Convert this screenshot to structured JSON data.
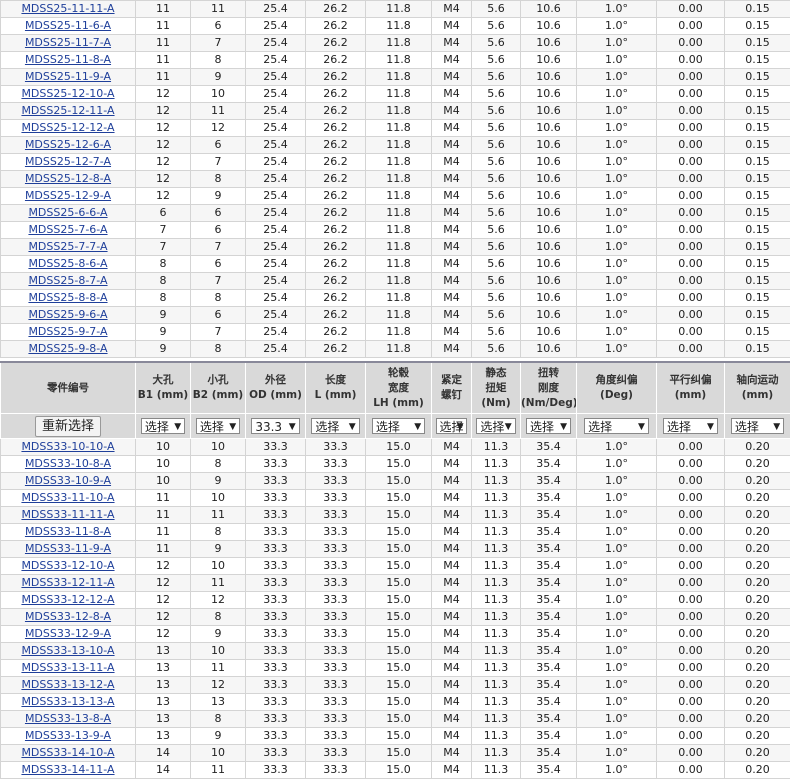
{
  "top_rows": [
    [
      "MDSS25-11-11-A",
      "11",
      "11",
      "25.4",
      "26.2",
      "11.8",
      "M4",
      "5.6",
      "10.6",
      "1.0°",
      "0.00",
      "0.15"
    ],
    [
      "MDSS25-11-6-A",
      "11",
      "6",
      "25.4",
      "26.2",
      "11.8",
      "M4",
      "5.6",
      "10.6",
      "1.0°",
      "0.00",
      "0.15"
    ],
    [
      "MDSS25-11-7-A",
      "11",
      "7",
      "25.4",
      "26.2",
      "11.8",
      "M4",
      "5.6",
      "10.6",
      "1.0°",
      "0.00",
      "0.15"
    ],
    [
      "MDSS25-11-8-A",
      "11",
      "8",
      "25.4",
      "26.2",
      "11.8",
      "M4",
      "5.6",
      "10.6",
      "1.0°",
      "0.00",
      "0.15"
    ],
    [
      "MDSS25-11-9-A",
      "11",
      "9",
      "25.4",
      "26.2",
      "11.8",
      "M4",
      "5.6",
      "10.6",
      "1.0°",
      "0.00",
      "0.15"
    ],
    [
      "MDSS25-12-10-A",
      "12",
      "10",
      "25.4",
      "26.2",
      "11.8",
      "M4",
      "5.6",
      "10.6",
      "1.0°",
      "0.00",
      "0.15"
    ],
    [
      "MDSS25-12-11-A",
      "12",
      "11",
      "25.4",
      "26.2",
      "11.8",
      "M4",
      "5.6",
      "10.6",
      "1.0°",
      "0.00",
      "0.15"
    ],
    [
      "MDSS25-12-12-A",
      "12",
      "12",
      "25.4",
      "26.2",
      "11.8",
      "M4",
      "5.6",
      "10.6",
      "1.0°",
      "0.00",
      "0.15"
    ],
    [
      "MDSS25-12-6-A",
      "12",
      "6",
      "25.4",
      "26.2",
      "11.8",
      "M4",
      "5.6",
      "10.6",
      "1.0°",
      "0.00",
      "0.15"
    ],
    [
      "MDSS25-12-7-A",
      "12",
      "7",
      "25.4",
      "26.2",
      "11.8",
      "M4",
      "5.6",
      "10.6",
      "1.0°",
      "0.00",
      "0.15"
    ],
    [
      "MDSS25-12-8-A",
      "12",
      "8",
      "25.4",
      "26.2",
      "11.8",
      "M4",
      "5.6",
      "10.6",
      "1.0°",
      "0.00",
      "0.15"
    ],
    [
      "MDSS25-12-9-A",
      "12",
      "9",
      "25.4",
      "26.2",
      "11.8",
      "M4",
      "5.6",
      "10.6",
      "1.0°",
      "0.00",
      "0.15"
    ],
    [
      "MDSS25-6-6-A",
      "6",
      "6",
      "25.4",
      "26.2",
      "11.8",
      "M4",
      "5.6",
      "10.6",
      "1.0°",
      "0.00",
      "0.15"
    ],
    [
      "MDSS25-7-6-A",
      "7",
      "6",
      "25.4",
      "26.2",
      "11.8",
      "M4",
      "5.6",
      "10.6",
      "1.0°",
      "0.00",
      "0.15"
    ],
    [
      "MDSS25-7-7-A",
      "7",
      "7",
      "25.4",
      "26.2",
      "11.8",
      "M4",
      "5.6",
      "10.6",
      "1.0°",
      "0.00",
      "0.15"
    ],
    [
      "MDSS25-8-6-A",
      "8",
      "6",
      "25.4",
      "26.2",
      "11.8",
      "M4",
      "5.6",
      "10.6",
      "1.0°",
      "0.00",
      "0.15"
    ],
    [
      "MDSS25-8-7-A",
      "8",
      "7",
      "25.4",
      "26.2",
      "11.8",
      "M4",
      "5.6",
      "10.6",
      "1.0°",
      "0.00",
      "0.15"
    ],
    [
      "MDSS25-8-8-A",
      "8",
      "8",
      "25.4",
      "26.2",
      "11.8",
      "M4",
      "5.6",
      "10.6",
      "1.0°",
      "0.00",
      "0.15"
    ],
    [
      "MDSS25-9-6-A",
      "9",
      "6",
      "25.4",
      "26.2",
      "11.8",
      "M4",
      "5.6",
      "10.6",
      "1.0°",
      "0.00",
      "0.15"
    ],
    [
      "MDSS25-9-7-A",
      "9",
      "7",
      "25.4",
      "26.2",
      "11.8",
      "M4",
      "5.6",
      "10.6",
      "1.0°",
      "0.00",
      "0.15"
    ],
    [
      "MDSS25-9-8-A",
      "9",
      "8",
      "25.4",
      "26.2",
      "11.8",
      "M4",
      "5.6",
      "10.6",
      "1.0°",
      "0.00",
      "0.15"
    ]
  ],
  "headers": [
    [
      "零件编号"
    ],
    [
      "大孔",
      "B1 (mm)"
    ],
    [
      "小孔",
      "B2 (mm)"
    ],
    [
      "外径",
      "OD (mm)"
    ],
    [
      "长度",
      "L (mm)"
    ],
    [
      "轮毂",
      "宽度",
      "LH (mm)"
    ],
    [
      "紧定",
      "螺钉"
    ],
    [
      "静态",
      "扭矩",
      "(Nm)"
    ],
    [
      "扭转",
      "刚度",
      "(Nm/Deg)"
    ],
    [
      "角度纠偏",
      "(Deg)"
    ],
    [
      "平行纠偏",
      "(mm)"
    ],
    [
      "轴向运动",
      "(mm)"
    ]
  ],
  "reset_label": "重新选择",
  "select_values": [
    "选择",
    "选择",
    "33.3",
    "选择",
    "选择",
    "选择",
    "选择",
    "选择",
    "选择",
    "选择",
    "选择"
  ],
  "bottom_rows": [
    [
      "MDSS33-10-10-A",
      "10",
      "10",
      "33.3",
      "33.3",
      "15.0",
      "M4",
      "11.3",
      "35.4",
      "1.0°",
      "0.00",
      "0.20"
    ],
    [
      "MDSS33-10-8-A",
      "10",
      "8",
      "33.3",
      "33.3",
      "15.0",
      "M4",
      "11.3",
      "35.4",
      "1.0°",
      "0.00",
      "0.20"
    ],
    [
      "MDSS33-10-9-A",
      "10",
      "9",
      "33.3",
      "33.3",
      "15.0",
      "M4",
      "11.3",
      "35.4",
      "1.0°",
      "0.00",
      "0.20"
    ],
    [
      "MDSS33-11-10-A",
      "11",
      "10",
      "33.3",
      "33.3",
      "15.0",
      "M4",
      "11.3",
      "35.4",
      "1.0°",
      "0.00",
      "0.20"
    ],
    [
      "MDSS33-11-11-A",
      "11",
      "11",
      "33.3",
      "33.3",
      "15.0",
      "M4",
      "11.3",
      "35.4",
      "1.0°",
      "0.00",
      "0.20"
    ],
    [
      "MDSS33-11-8-A",
      "11",
      "8",
      "33.3",
      "33.3",
      "15.0",
      "M4",
      "11.3",
      "35.4",
      "1.0°",
      "0.00",
      "0.20"
    ],
    [
      "MDSS33-11-9-A",
      "11",
      "9",
      "33.3",
      "33.3",
      "15.0",
      "M4",
      "11.3",
      "35.4",
      "1.0°",
      "0.00",
      "0.20"
    ],
    [
      "MDSS33-12-10-A",
      "12",
      "10",
      "33.3",
      "33.3",
      "15.0",
      "M4",
      "11.3",
      "35.4",
      "1.0°",
      "0.00",
      "0.20"
    ],
    [
      "MDSS33-12-11-A",
      "12",
      "11",
      "33.3",
      "33.3",
      "15.0",
      "M4",
      "11.3",
      "35.4",
      "1.0°",
      "0.00",
      "0.20"
    ],
    [
      "MDSS33-12-12-A",
      "12",
      "12",
      "33.3",
      "33.3",
      "15.0",
      "M4",
      "11.3",
      "35.4",
      "1.0°",
      "0.00",
      "0.20"
    ],
    [
      "MDSS33-12-8-A",
      "12",
      "8",
      "33.3",
      "33.3",
      "15.0",
      "M4",
      "11.3",
      "35.4",
      "1.0°",
      "0.00",
      "0.20"
    ],
    [
      "MDSS33-12-9-A",
      "12",
      "9",
      "33.3",
      "33.3",
      "15.0",
      "M4",
      "11.3",
      "35.4",
      "1.0°",
      "0.00",
      "0.20"
    ],
    [
      "MDSS33-13-10-A",
      "13",
      "10",
      "33.3",
      "33.3",
      "15.0",
      "M4",
      "11.3",
      "35.4",
      "1.0°",
      "0.00",
      "0.20"
    ],
    [
      "MDSS33-13-11-A",
      "13",
      "11",
      "33.3",
      "33.3",
      "15.0",
      "M4",
      "11.3",
      "35.4",
      "1.0°",
      "0.00",
      "0.20"
    ],
    [
      "MDSS33-13-12-A",
      "13",
      "12",
      "33.3",
      "33.3",
      "15.0",
      "M4",
      "11.3",
      "35.4",
      "1.0°",
      "0.00",
      "0.20"
    ],
    [
      "MDSS33-13-13-A",
      "13",
      "13",
      "33.3",
      "33.3",
      "15.0",
      "M4",
      "11.3",
      "35.4",
      "1.0°",
      "0.00",
      "0.20"
    ],
    [
      "MDSS33-13-8-A",
      "13",
      "8",
      "33.3",
      "33.3",
      "15.0",
      "M4",
      "11.3",
      "35.4",
      "1.0°",
      "0.00",
      "0.20"
    ],
    [
      "MDSS33-13-9-A",
      "13",
      "9",
      "33.3",
      "33.3",
      "15.0",
      "M4",
      "11.3",
      "35.4",
      "1.0°",
      "0.00",
      "0.20"
    ],
    [
      "MDSS33-14-10-A",
      "14",
      "10",
      "33.3",
      "33.3",
      "15.0",
      "M4",
      "11.3",
      "35.4",
      "1.0°",
      "0.00",
      "0.20"
    ],
    [
      "MDSS33-14-11-A",
      "14",
      "11",
      "33.3",
      "33.3",
      "15.0",
      "M4",
      "11.3",
      "35.4",
      "1.0°",
      "0.00",
      "0.20"
    ]
  ],
  "colors": {
    "link": "#1f3f9a",
    "header_bg": "#d9d9d9",
    "stripe": "#f6f6f6"
  }
}
